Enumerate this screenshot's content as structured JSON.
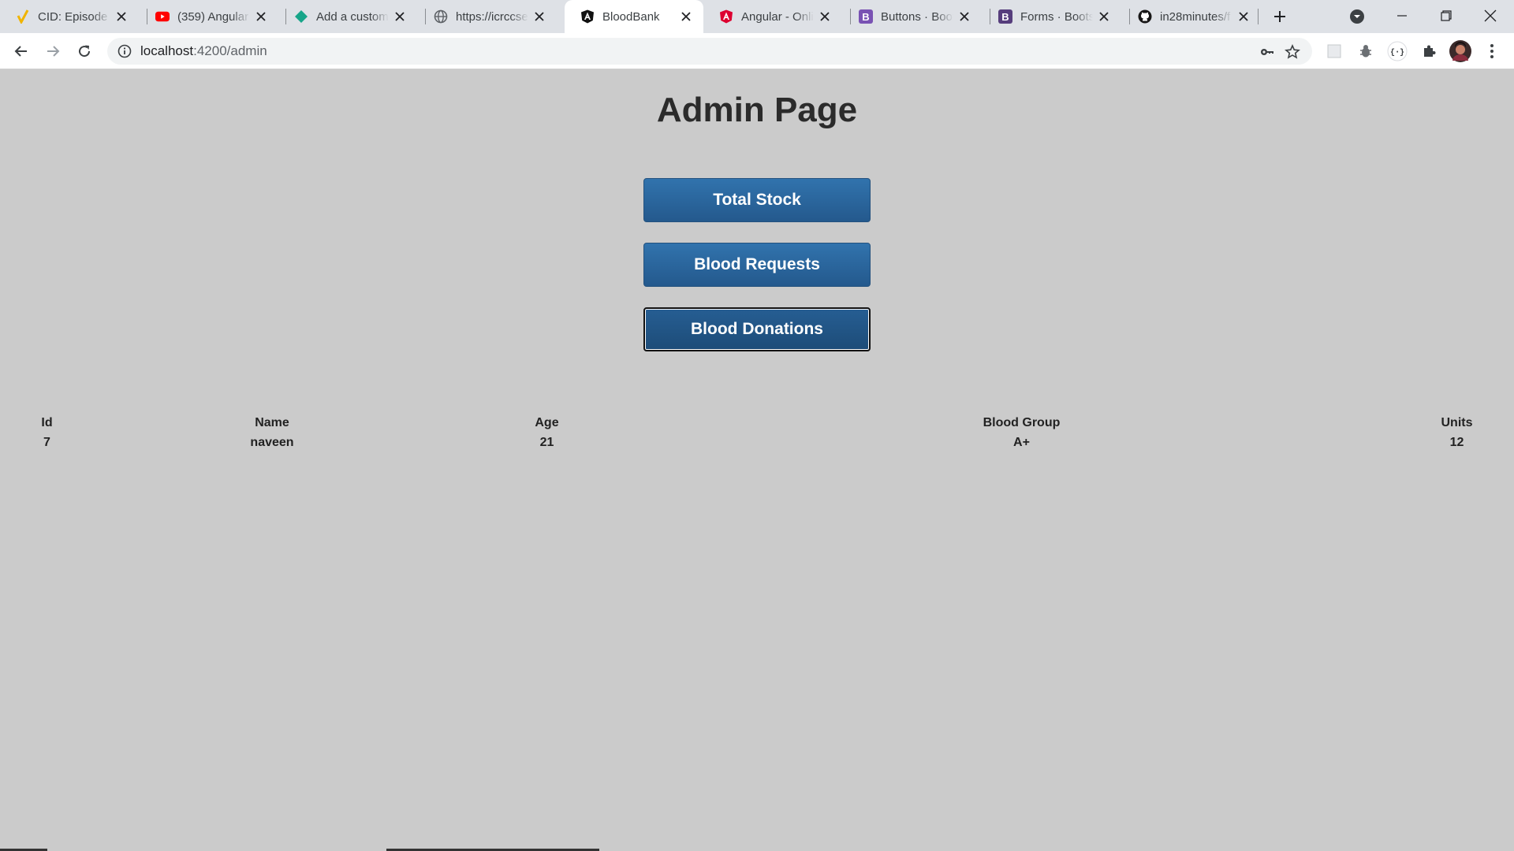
{
  "browser": {
    "tabs": [
      {
        "title": "CID: Episode 1",
        "favicon": "check-logo-icon",
        "active": false
      },
      {
        "title": "(359) Angular 1",
        "favicon": "youtube-icon",
        "active": false
      },
      {
        "title": "Add a custom",
        "favicon": "diamond-icon",
        "active": false
      },
      {
        "title": "https://icrccse",
        "favicon": "globe-icon",
        "active": false
      },
      {
        "title": "BloodBank",
        "favicon": "angular-icon",
        "active": true
      },
      {
        "title": "Angular - Onli",
        "favicon": "angular-red-icon",
        "active": false
      },
      {
        "title": "Buttons · Boot",
        "favicon": "bootstrap-icon",
        "active": false
      },
      {
        "title": "Forms · Bootst",
        "favicon": "bootstrap-icon",
        "active": false
      },
      {
        "title": "in28minutes/f",
        "favicon": "github-icon",
        "active": false
      }
    ],
    "address": {
      "host": "localhost",
      "path": ":4200/admin"
    },
    "colors": {
      "tabstrip": "#dee1e6",
      "toolbar": "#ffffff",
      "omnibox": "#f1f3f4"
    }
  },
  "page": {
    "title": "Admin Page",
    "buttons": {
      "total_stock": "Total Stock",
      "blood_requests": "Blood Requests",
      "blood_donations": "Blood Donations"
    },
    "table": {
      "headers": [
        "Id",
        "Name",
        "Age",
        "Blood Group",
        "Units"
      ],
      "rows": [
        [
          "7",
          "naveen",
          "21",
          "A+",
          "12"
        ]
      ]
    },
    "colors": {
      "background": "#cbcbcb",
      "button": "#2b68a0",
      "button_text": "#ffffff"
    }
  }
}
